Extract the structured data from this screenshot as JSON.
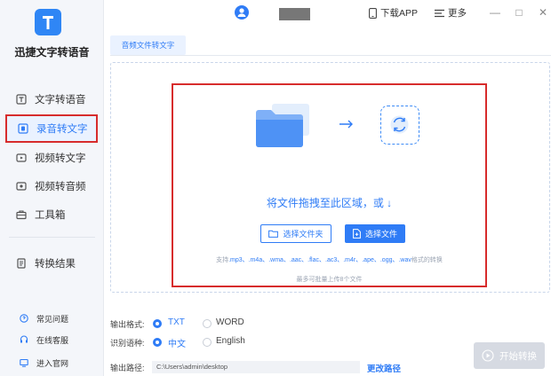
{
  "app": {
    "title": "迅捷文字转语音"
  },
  "sidebar": {
    "items": [
      {
        "label": "文字转语音",
        "icon": "text-to-speech-icon"
      },
      {
        "label": "录音转文字",
        "icon": "recording-icon",
        "active": true
      },
      {
        "label": "视频转文字",
        "icon": "video-icon"
      },
      {
        "label": "视频转音频",
        "icon": "video-audio-icon"
      },
      {
        "label": "工具箱",
        "icon": "toolbox-icon"
      },
      {
        "label": "转换结果",
        "icon": "result-icon"
      }
    ],
    "bottom": [
      {
        "label": "常见问题",
        "icon": "question-icon"
      },
      {
        "label": "在线客服",
        "icon": "headset-icon"
      },
      {
        "label": "进入官网",
        "icon": "website-icon"
      }
    ]
  },
  "topbar": {
    "download": "下载APP",
    "more": "更多",
    "window_controls": {
      "minimize": "—",
      "maximize": "□",
      "close": "✕"
    }
  },
  "tab": {
    "label": "音频文件转文字"
  },
  "dropzone": {
    "drag_text": "将文件拖拽至此区域，或 ↓",
    "choose_folder": "选择文件夹",
    "choose_file": "选择文件",
    "formats_prefix": "支持",
    "formats": ".mp3、.m4a、.wma、.aac、.flac、.ac3、.m4r、.ape、.ogg、.wav",
    "formats_suffix": "格式的转换",
    "limit": "最多可批量上传8个文件"
  },
  "options": {
    "output_format_label": "输出格式:",
    "format_options": [
      {
        "label": "TXT",
        "selected": true
      },
      {
        "label": "WORD",
        "selected": false
      }
    ],
    "language_label": "识别语种:",
    "language_options": [
      {
        "label": "中文",
        "selected": true
      },
      {
        "label": "English",
        "selected": false
      }
    ],
    "path_label": "输出路径:",
    "path_value": "C:\\Users\\admin\\desktop",
    "change_path": "更改路径",
    "start": "开始转换"
  },
  "colors": {
    "accent": "#2f7cf6",
    "highlight_border": "#d72c2c",
    "sidebar_bg": "#f4f6fa"
  }
}
